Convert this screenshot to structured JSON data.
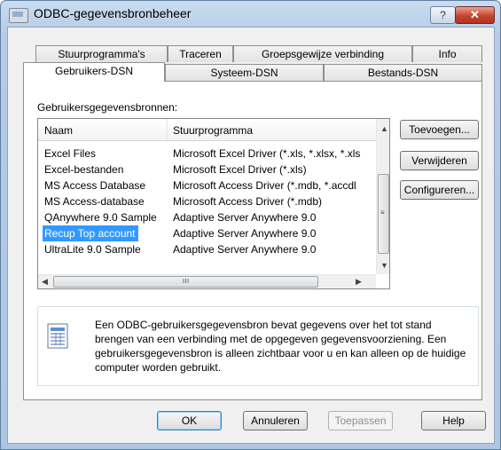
{
  "window": {
    "title": "ODBC-gegevensbronbeheer",
    "help_label": "?",
    "close_label": "✕"
  },
  "tabs": {
    "row1": [
      "Stuurprogramma's",
      "Traceren",
      "Groepsgewijze verbinding",
      "Info"
    ],
    "row2": [
      "Gebruikers-DSN",
      "Systeem-DSN",
      "Bestands-DSN"
    ],
    "active": "Gebruikers-DSN"
  },
  "panel": {
    "section_label": "Gebruikersgegevensbronnen:",
    "columns": {
      "name": "Naam",
      "driver": "Stuurprogramma"
    },
    "rows": [
      {
        "name": "Excel Files",
        "driver": "Microsoft Excel Driver (*.xls, *.xlsx, *.xls"
      },
      {
        "name": "Excel-bestanden",
        "driver": "Microsoft Excel Driver (*.xls)"
      },
      {
        "name": "MS Access Database",
        "driver": "Microsoft Access Driver (*.mdb, *.accdl"
      },
      {
        "name": "MS Access-database",
        "driver": "Microsoft Access Driver (*.mdb)"
      },
      {
        "name": "QAnywhere 9.0 Sample",
        "driver": "Adaptive Server Anywhere 9.0"
      },
      {
        "name": "Recup Top account",
        "driver": "Adaptive Server Anywhere 9.0"
      },
      {
        "name": "UltraLite 9.0 Sample",
        "driver": "Adaptive Server Anywhere 9.0"
      }
    ],
    "selected_row": "Recup Top account",
    "buttons": {
      "add": "Toevoegen...",
      "remove": "Verwijderen",
      "configure": "Configureren..."
    },
    "info_text": "Een ODBC-gebruikersgegevensbron bevat gegevens over het tot stand brengen van een verbinding met de opgegeven gegevensvoorziening. Een gebruikersgegevensbron is alleen zichtbaar voor u en kan alleen op de huidige computer worden gebruikt."
  },
  "footer": {
    "ok": "OK",
    "cancel": "Annuleren",
    "apply": "Toepassen",
    "help": "Help"
  },
  "icons": {
    "app": "odbc-app-icon",
    "info": "data-source-icon"
  },
  "colors": {
    "selection": "#3399ff",
    "close": "#c5432e"
  }
}
